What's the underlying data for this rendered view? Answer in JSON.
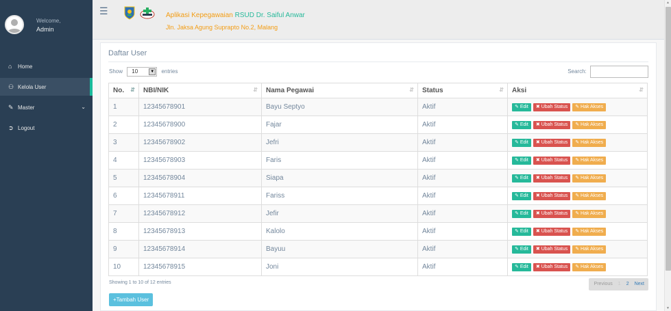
{
  "sidebar": {
    "welcome": "Welcome,",
    "username": "Admin",
    "items": [
      {
        "label": "Home",
        "icon": "home-icon"
      },
      {
        "label": "Kelola User",
        "icon": "users-icon",
        "active": true
      },
      {
        "label": "Master",
        "icon": "edit-icon",
        "chevron": "chevron-down-icon"
      },
      {
        "label": "Logout",
        "icon": "sign-out-icon"
      }
    ]
  },
  "header": {
    "title_prefix": "Aplikasi Kepegawaian ",
    "title_highlight": "RSUD Dr. Saiful Anwar",
    "address": "Jln. Jaksa Agung Suprapto No.2, Malang"
  },
  "panel": {
    "title": "Daftar User",
    "show_label": "Show",
    "entries_value": "10",
    "entries_label": "entries",
    "search_label": "Search:",
    "search_value": ""
  },
  "table": {
    "columns": [
      "No.",
      "NBI/NIK",
      "Nama Pegawai",
      "Status",
      "Aksi"
    ],
    "rows": [
      [
        "1",
        "12345678901",
        "Bayu Septyo",
        "Aktif"
      ],
      [
        "2",
        "12345678900",
        "Fajar",
        "Aktif"
      ],
      [
        "3",
        "12345678902",
        "Jefri",
        "Aktif"
      ],
      [
        "4",
        "12345678903",
        "Faris",
        "Aktif"
      ],
      [
        "5",
        "12345678904",
        "Siapa",
        "Aktif"
      ],
      [
        "6",
        "12345678911",
        "Fariss",
        "Aktif"
      ],
      [
        "7",
        "12345678912",
        "Jefir",
        "Aktif"
      ],
      [
        "8",
        "12345678913",
        "Kalolo",
        "Aktif"
      ],
      [
        "9",
        "12345678914",
        "Bayuu",
        "Aktif"
      ],
      [
        "10",
        "12345678915",
        "Joni",
        "Aktif"
      ]
    ],
    "actions": {
      "edit": "Edit",
      "status": "Ubah Status",
      "akses": "Hak Akses"
    }
  },
  "footer": {
    "info": "Showing 1 to 10 of 12 entries",
    "prev": "Previous",
    "page1": "1",
    "page2": "2",
    "next": "Next",
    "add_button": "Tambah User"
  },
  "colors": {
    "sidebar": "#2a3f54",
    "accent_green": "#26b99a",
    "danger": "#d9534f",
    "warning": "#f0ad4e",
    "info": "#5bc0de",
    "title_orange": "#f39c12"
  }
}
